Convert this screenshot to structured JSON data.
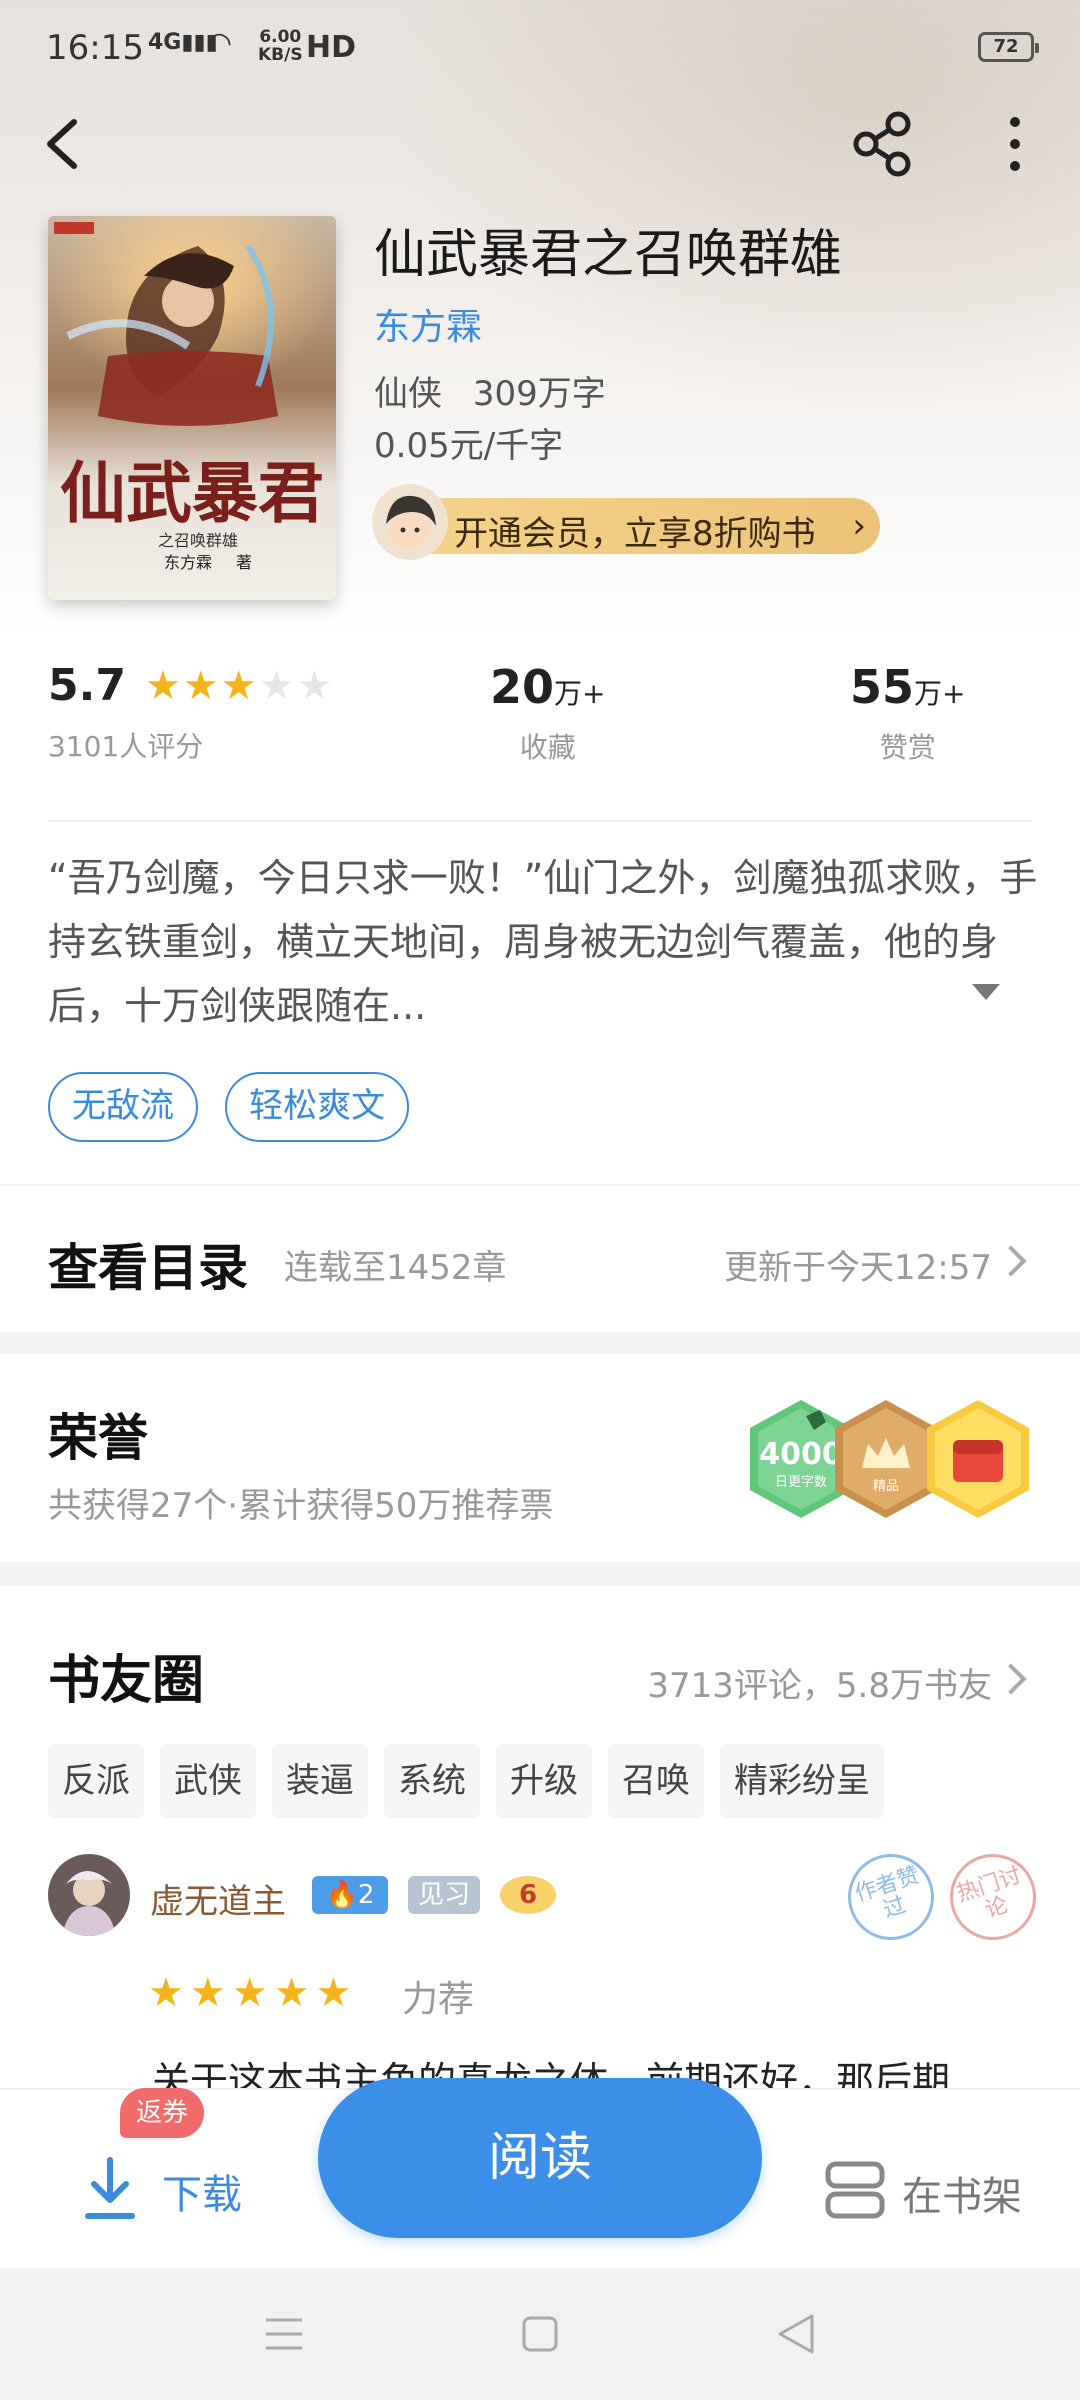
{
  "status_bar": {
    "time": "16:15",
    "network": "4G",
    "speed_value": "6.00",
    "speed_unit": "KB/S",
    "hd": "HD",
    "battery": "72"
  },
  "toolbar": {
    "back_icon": "back-arrow-icon",
    "share_icon": "share-icon",
    "more_icon": "more-vertical-icon"
  },
  "book": {
    "title": "仙武暴君之召唤群雄",
    "author": "东方霖",
    "genre": "仙侠",
    "word_count": "309万字",
    "price": "0.05元/千字",
    "vip_promo": "开通会员，立享8折购书",
    "cover": {
      "big_title": "仙武暴君",
      "subtitle": "之召唤群雄",
      "author_tag": "东方霖",
      "author_suffix": "著"
    }
  },
  "stats": {
    "rating": "5.7",
    "rating_stars": 3,
    "rating_count": "3101人评分",
    "collect_value": "20",
    "collect_unit": "万+",
    "collect_label": "收藏",
    "reward_value": "55",
    "reward_unit": "万+",
    "reward_label": "赞赏"
  },
  "description": "“吾乃剑魔，今日只求一败！”仙门之外，剑魔独孤求败，手持玄铁重剑，横立天地间，周身被无边剑气覆盖，他的身后，十万剑侠跟随在...",
  "tags": [
    "无敌流",
    "轻松爽文"
  ],
  "toc": {
    "title": "查看目录",
    "status": "连载至1452章",
    "updated": "更新于今天12:57"
  },
  "honor": {
    "title": "荣誉",
    "summary": "共获得27个·累计获得50万推荐票",
    "badge1_value": "4000",
    "badge1_label": "日更字数",
    "badge2_label": "精品"
  },
  "circle": {
    "title": "书友圈",
    "summary": "3713评论，5.8万书友",
    "topics": [
      "反派",
      "武侠",
      "装逼",
      "系统",
      "升级",
      "召唤",
      "精彩纷呈"
    ],
    "post": {
      "user": "虚无道主",
      "fan_level": "2",
      "rank": "见习",
      "medal": "6",
      "stamp1": "作者赞过",
      "stamp2": "热门讨论",
      "stars": 5,
      "recommend": "力荐",
      "text": "关于这本书主角的真龙之体，前期还好，那后期"
    }
  },
  "bottom": {
    "download": "下载",
    "coupon": "返券",
    "read": "阅读",
    "shelf": "在书架"
  },
  "colors": {
    "accent": "#3b8fe8",
    "star": "#f6b41b",
    "vip": "#ebc278",
    "coupon": "#f26b6b"
  }
}
